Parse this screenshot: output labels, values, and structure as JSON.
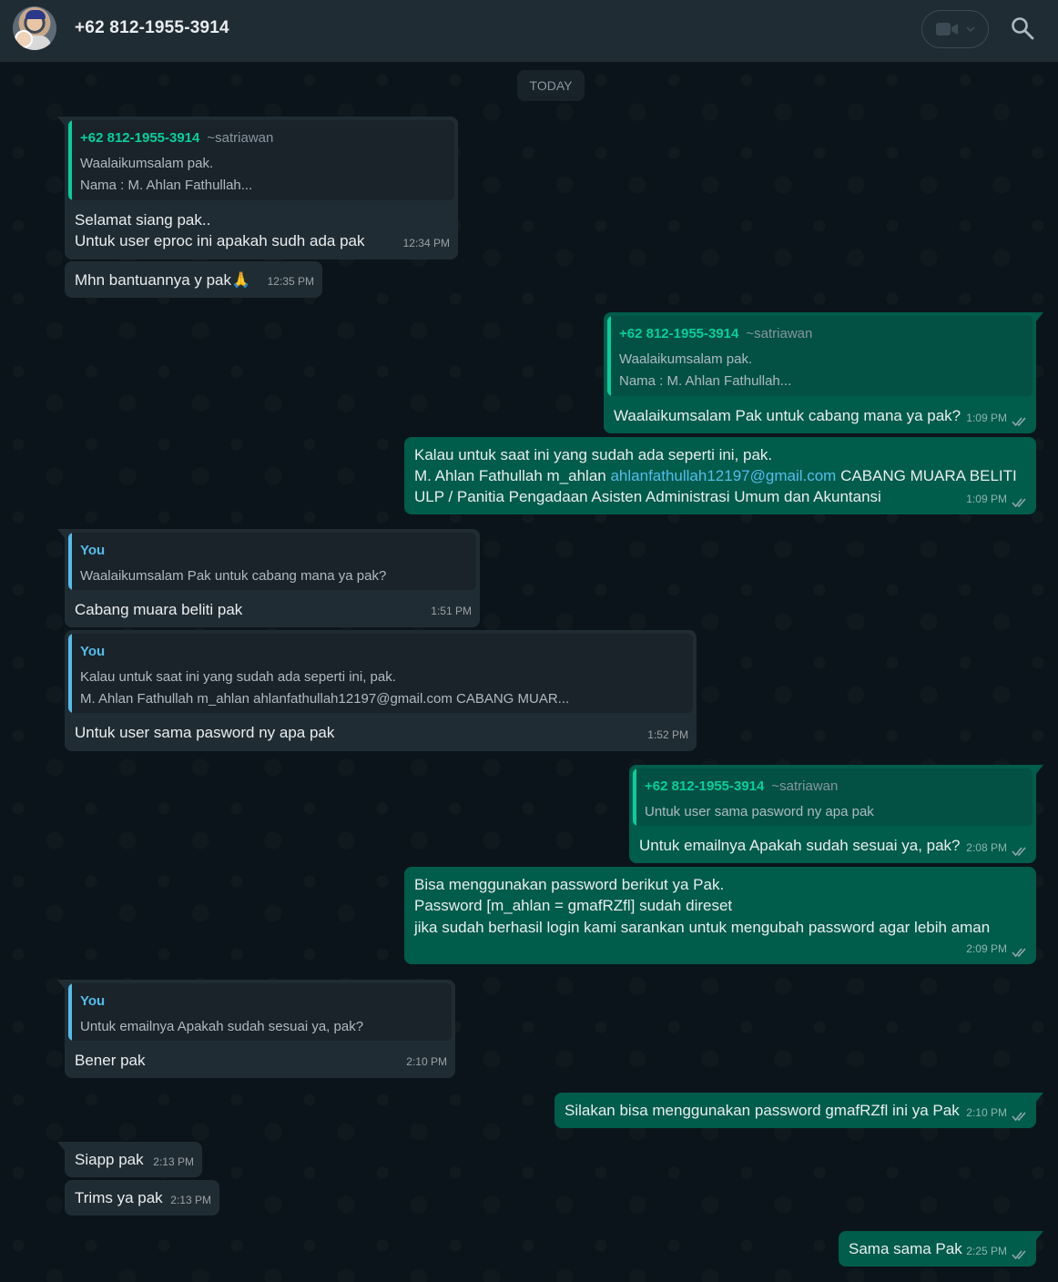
{
  "header": {
    "contact_name": "+62 812-1955-3914",
    "icons": [
      "avatar",
      "video-call-icon",
      "chevron-down-icon",
      "search-icon"
    ]
  },
  "date_separator": "TODAY",
  "colors": {
    "incoming": "#202c33",
    "outgoing": "#005c4b",
    "quote_green": "#06cf9c",
    "quote_blue": "#53bdeb",
    "background": "#0b141a"
  },
  "messages": [
    {
      "direction": "in",
      "quote": {
        "author": "+62 812-1955-3914",
        "pushname": "~satriawan",
        "lines": [
          "Waalaikumsalam pak.",
          "Nama : M. Ahlan Fathullah..."
        ]
      },
      "lines": [
        "Selamat siang pak..",
        "Untuk user eproc ini apakah sudh ada pak"
      ],
      "time": "12:34 PM"
    },
    {
      "direction": "in",
      "lines": [
        "Mhn bantuannya y pak"
      ],
      "emoji": "🙏",
      "time": "12:35 PM"
    },
    {
      "direction": "out",
      "quote": {
        "author": "+62 812-1955-3914",
        "pushname": "~satriawan",
        "lines": [
          "Waalaikumsalam pak.",
          "Nama : M. Ahlan Fathullah..."
        ]
      },
      "lines": [
        "Waalaikumsalam Pak untuk cabang mana ya pak?"
      ],
      "time": "1:09 PM"
    },
    {
      "direction": "out",
      "line1": "Kalau untuk saat ini yang sudah ada seperti ini, pak.",
      "line2_prefix": "M. Ahlan Fathullah  m_ahlan ",
      "line2_email": "ahlanfathullah12197@gmail.com",
      "line2_suffix": "CABANG MUARA BELITI",
      "line3": "ULP / Panitia Pengadaan Asisten Administrasi Umum dan Akuntansi",
      "time": "1:09 PM"
    },
    {
      "direction": "in",
      "quote": {
        "author": "You",
        "lines": [
          "Waalaikumsalam Pak untuk cabang mana ya pak?"
        ]
      },
      "lines": [
        "Cabang muara beliti pak"
      ],
      "time": "1:51 PM"
    },
    {
      "direction": "in",
      "quote": {
        "author": "You",
        "lines": [
          "Kalau untuk saat ini yang sudah ada seperti ini, pak.",
          "M. Ahlan Fathullah  m_ahlan  ahlanfathullah12197@gmail.com   CABANG MUAR..."
        ]
      },
      "lines": [
        "Untuk user sama pasword ny apa pak"
      ],
      "time": "1:52 PM"
    },
    {
      "direction": "out",
      "quote": {
        "author": "+62 812-1955-3914",
        "pushname": "~satriawan",
        "lines": [
          "Untuk user sama pasword ny apa pak"
        ]
      },
      "lines": [
        "Untuk emailnya Apakah sudah sesuai ya, pak?"
      ],
      "time": "2:08 PM"
    },
    {
      "direction": "out",
      "lines": [
        "Bisa menggunakan password berikut ya Pak.",
        "Password [m_ahlan = gmafRZfl] sudah direset",
        "jika sudah berhasil login kami sarankan untuk mengubah password agar lebih aman"
      ],
      "time": "2:09 PM"
    },
    {
      "direction": "in",
      "quote": {
        "author": "You",
        "lines": [
          "Untuk emailnya Apakah sudah sesuai ya, pak?"
        ]
      },
      "lines": [
        "Bener pak"
      ],
      "time": "2:10 PM"
    },
    {
      "direction": "out",
      "lines": [
        "Silakan bisa menggunakan password gmafRZfl ini ya Pak"
      ],
      "time": "2:10 PM"
    },
    {
      "direction": "in",
      "lines": [
        "Siapp pak"
      ],
      "time": "2:13 PM"
    },
    {
      "direction": "in",
      "lines": [
        "Trims ya pak"
      ],
      "time": "2:13 PM"
    },
    {
      "direction": "out",
      "lines": [
        "Sama sama Pak"
      ],
      "time": "2:25 PM"
    }
  ]
}
